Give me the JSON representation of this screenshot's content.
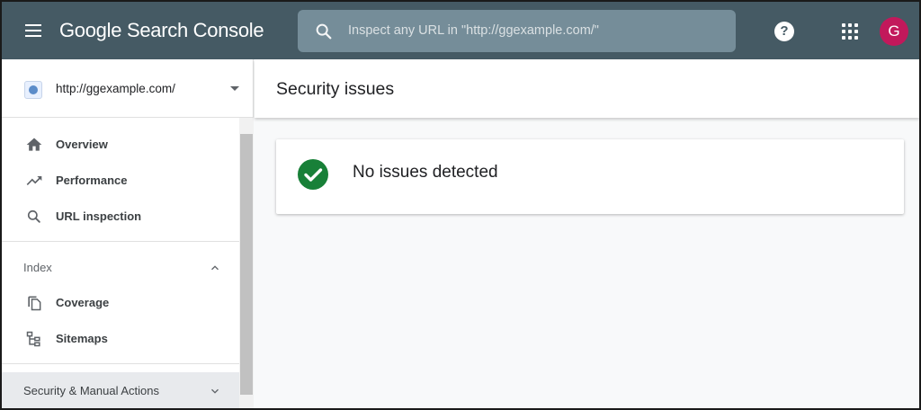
{
  "app": {
    "title_part1": "Google",
    "title_part2": "Search Console"
  },
  "search": {
    "placeholder": "Inspect any URL in \"http://ggexample.com/\"",
    "value": ""
  },
  "header": {
    "help_glyph": "?",
    "avatar_initial": "G",
    "avatar_color": "#c2185b",
    "brand_color": "#455a64"
  },
  "sidebar": {
    "property": "http://ggexample.com/",
    "items": [
      {
        "label": "Overview",
        "icon": "home-icon"
      },
      {
        "label": "Performance",
        "icon": "trending-up-icon"
      },
      {
        "label": "URL inspection",
        "icon": "search-icon"
      }
    ],
    "sections": [
      {
        "label": "Index",
        "expanded": true,
        "items": [
          {
            "label": "Coverage",
            "icon": "copy-icon"
          },
          {
            "label": "Sitemaps",
            "icon": "sitemap-icon"
          }
        ]
      },
      {
        "label": "Security & Manual Actions",
        "expanded": false,
        "items": []
      }
    ]
  },
  "main": {
    "page_title": "Security issues",
    "status_text": "No issues detected",
    "status_icon": "check-circle-icon",
    "status_color": "#188038"
  }
}
